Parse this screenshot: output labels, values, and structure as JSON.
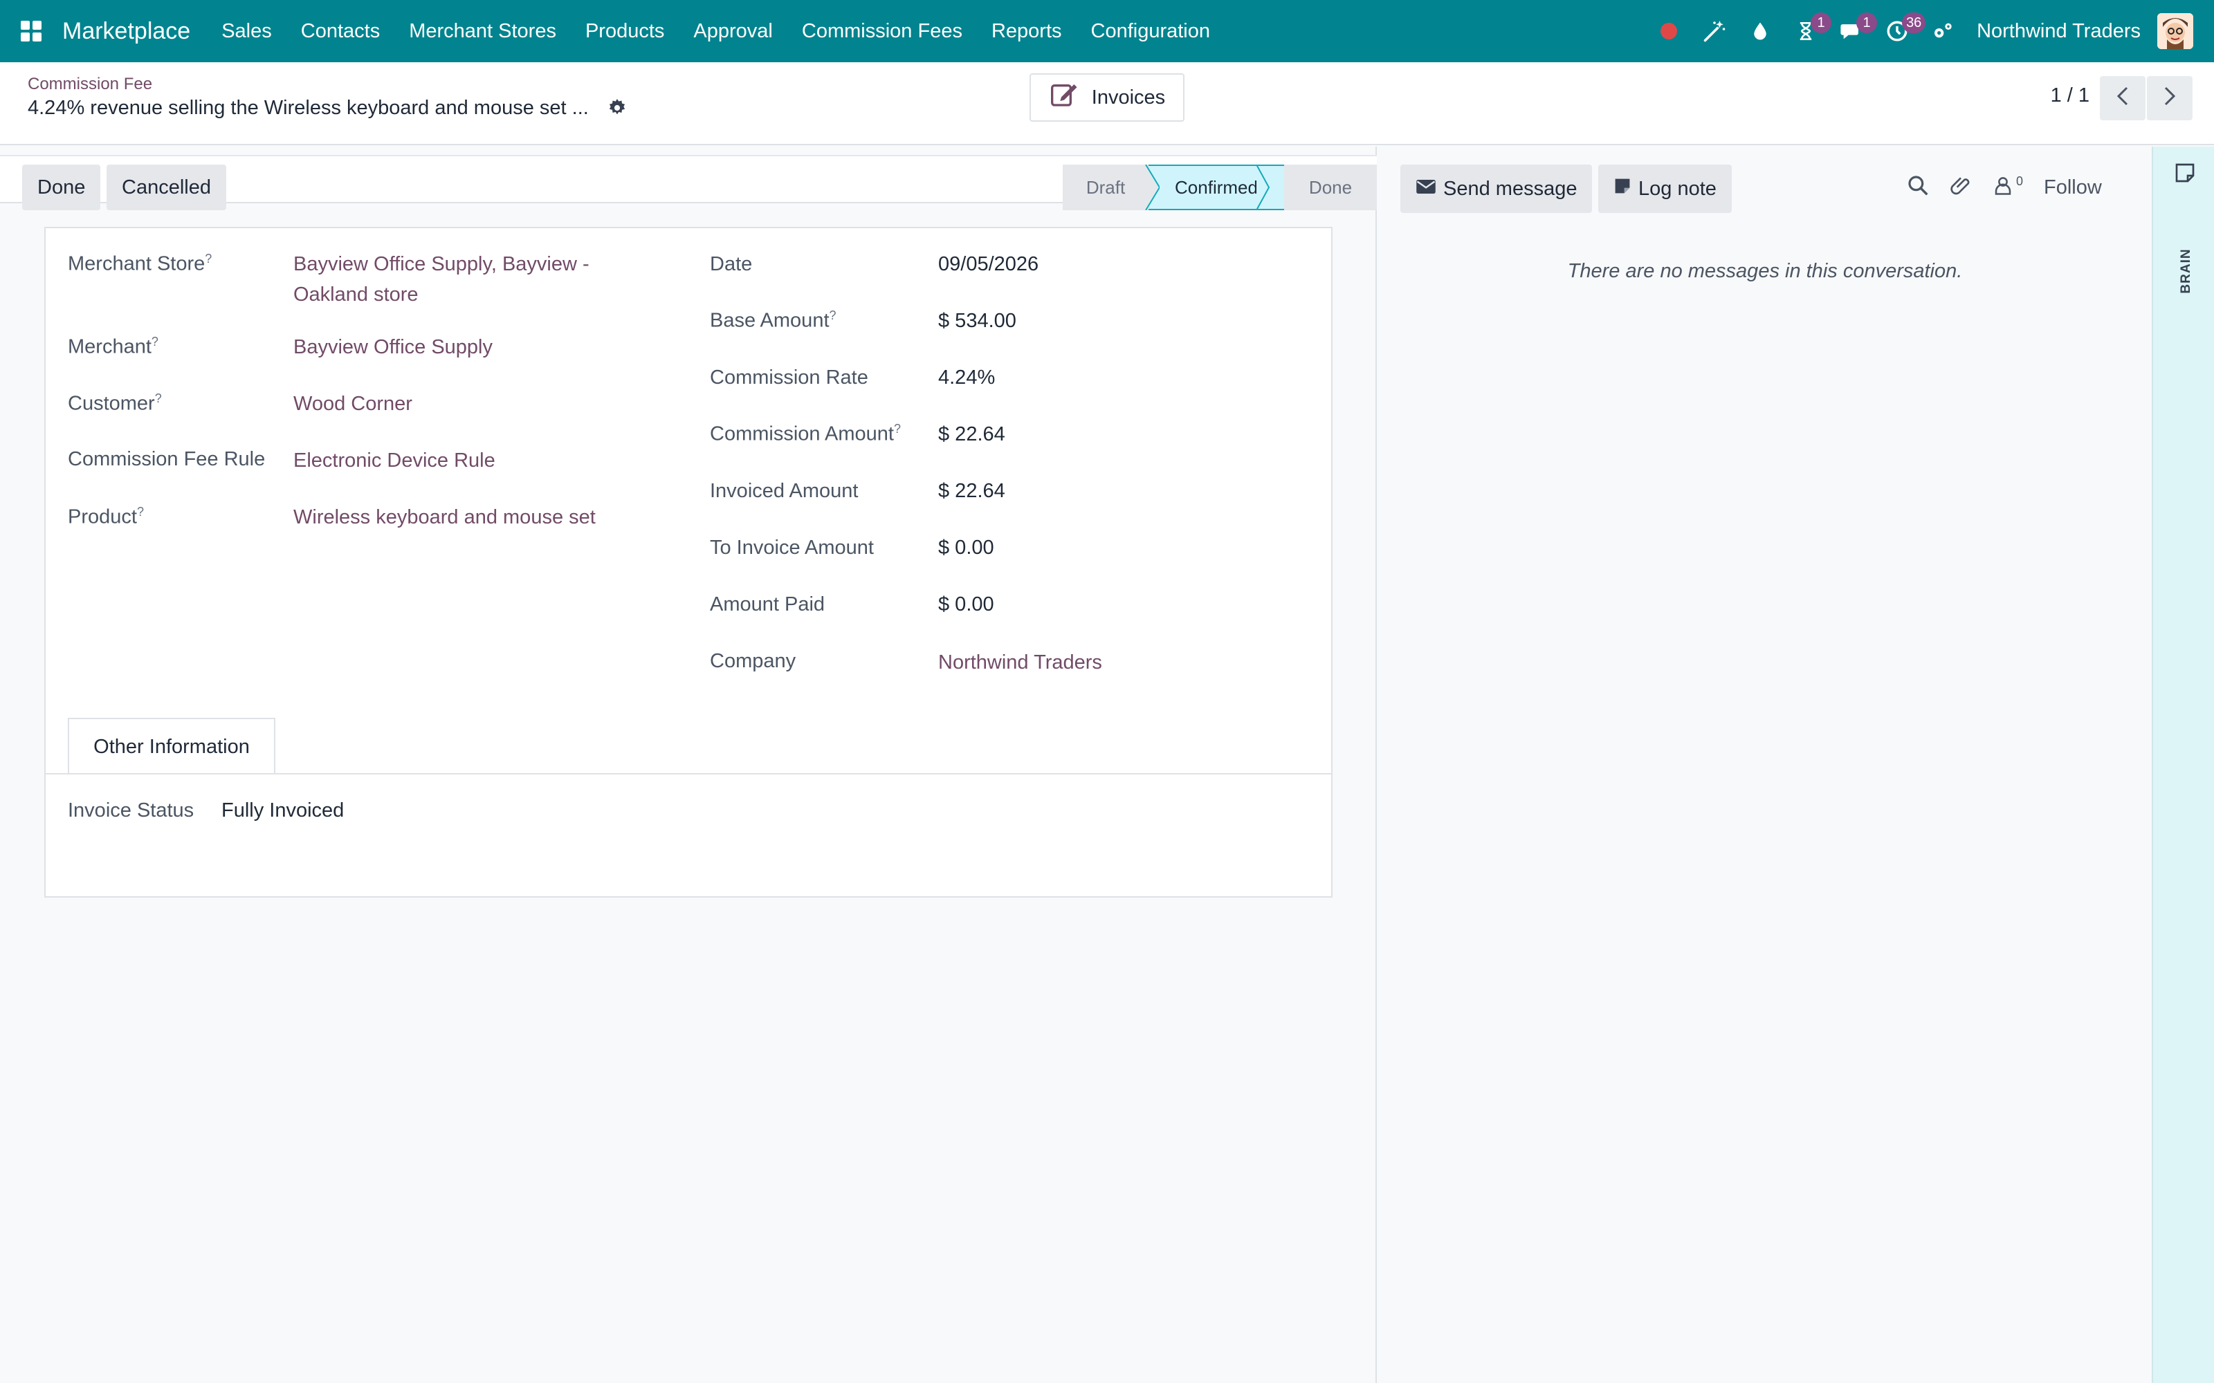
{
  "navbar": {
    "brand": "Marketplace",
    "menu": [
      "Sales",
      "Contacts",
      "Merchant Stores",
      "Products",
      "Approval",
      "Commission Fees",
      "Reports",
      "Configuration"
    ],
    "badges": {
      "activity": "1",
      "messages": "1",
      "clock": "36"
    },
    "company": "Northwind Traders"
  },
  "breadcrumb": {
    "parent": "Commission Fee",
    "current": "4.24% revenue selling the Wireless keyboard and mouse set ..."
  },
  "smart_button": {
    "label": "Invoices"
  },
  "pager": {
    "value": "1 / 1"
  },
  "statusbar": {
    "buttons": [
      "Done",
      "Cancelled"
    ],
    "stages": [
      "Draft",
      "Confirmed",
      "Done"
    ],
    "active_stage": "Confirmed"
  },
  "form": {
    "left": [
      {
        "label": "Merchant Store",
        "help": "?",
        "value_line1": "Bayview Office Supply, Bayview -",
        "value_line2": "Oakland store"
      },
      {
        "label": "Merchant",
        "help": "?",
        "value": "Bayview Office Supply"
      },
      {
        "label": "Customer",
        "help": "?",
        "value": "Wood Corner"
      },
      {
        "label": "Commission Fee Rule",
        "value": "Electronic Device Rule"
      },
      {
        "label": "Product",
        "help": "?",
        "value": "Wireless keyboard and mouse set"
      }
    ],
    "right": [
      {
        "label": "Date",
        "value": "09/05/2026"
      },
      {
        "label": "Base Amount",
        "help": "?",
        "value": "$ 534.00"
      },
      {
        "label": "Commission Rate",
        "value": "4.24%"
      },
      {
        "label": "Commission Amount",
        "help": "?",
        "value": "$ 22.64"
      },
      {
        "label": "Invoiced Amount",
        "value": "$ 22.64"
      },
      {
        "label": "To Invoice Amount",
        "value": "$ 0.00"
      },
      {
        "label": "Amount Paid",
        "value": "$ 0.00"
      },
      {
        "label": "Company",
        "value": "Northwind Traders"
      }
    ],
    "tab": "Other Information",
    "invoice_status_label": "Invoice Status",
    "invoice_status_value": "Fully Invoiced"
  },
  "chatter": {
    "send_message": "Send message",
    "log_note": "Log note",
    "followers_count": "0",
    "follow": "Follow",
    "empty": "There are no messages in this conversation."
  },
  "brain": {
    "label": "BRAIN"
  }
}
